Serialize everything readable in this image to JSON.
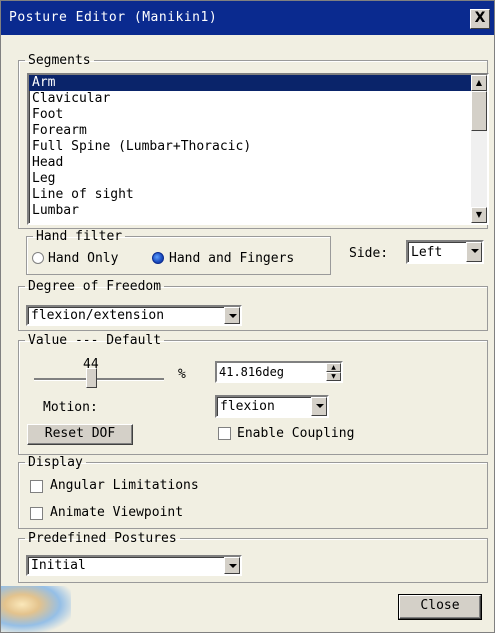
{
  "window": {
    "title": "Posture Editor (Manikin1)",
    "close_glyph": "X"
  },
  "segments": {
    "legend": "Segments",
    "items": [
      "Arm",
      "Clavicular",
      "Foot",
      "Forearm",
      "Full Spine (Lumbar+Thoracic)",
      "Head",
      "Leg",
      "Line of sight",
      "Lumbar"
    ],
    "selected": "Arm"
  },
  "hand_filter": {
    "legend": "Hand filter",
    "options": [
      "Hand Only",
      "Hand and Fingers"
    ],
    "selected": "Hand and Fingers"
  },
  "side": {
    "label": "Side:",
    "value": "Left"
  },
  "dof": {
    "legend": "Degree of Freedom",
    "value": "flexion/extension"
  },
  "value_group": {
    "legend": "Value --- Default",
    "slider_value": "44",
    "slider_level_percent": 44,
    "percent_sign": "%",
    "angle_value": "41.816deg",
    "motion_label": "Motion:",
    "motion_value": "flexion",
    "reset_label": "Reset DOF",
    "coupling_label": "Enable Coupling"
  },
  "display": {
    "legend": "Display",
    "angular_label": "Angular Limitations",
    "animate_label": "Animate Viewpoint"
  },
  "predefined": {
    "legend": "Predefined Postures",
    "value": "Initial"
  },
  "close_label": "Close",
  "colors": {
    "title_bar": "#0a2a8f",
    "selection": "#0a246a",
    "dialog_bg": "#f1efe2"
  }
}
